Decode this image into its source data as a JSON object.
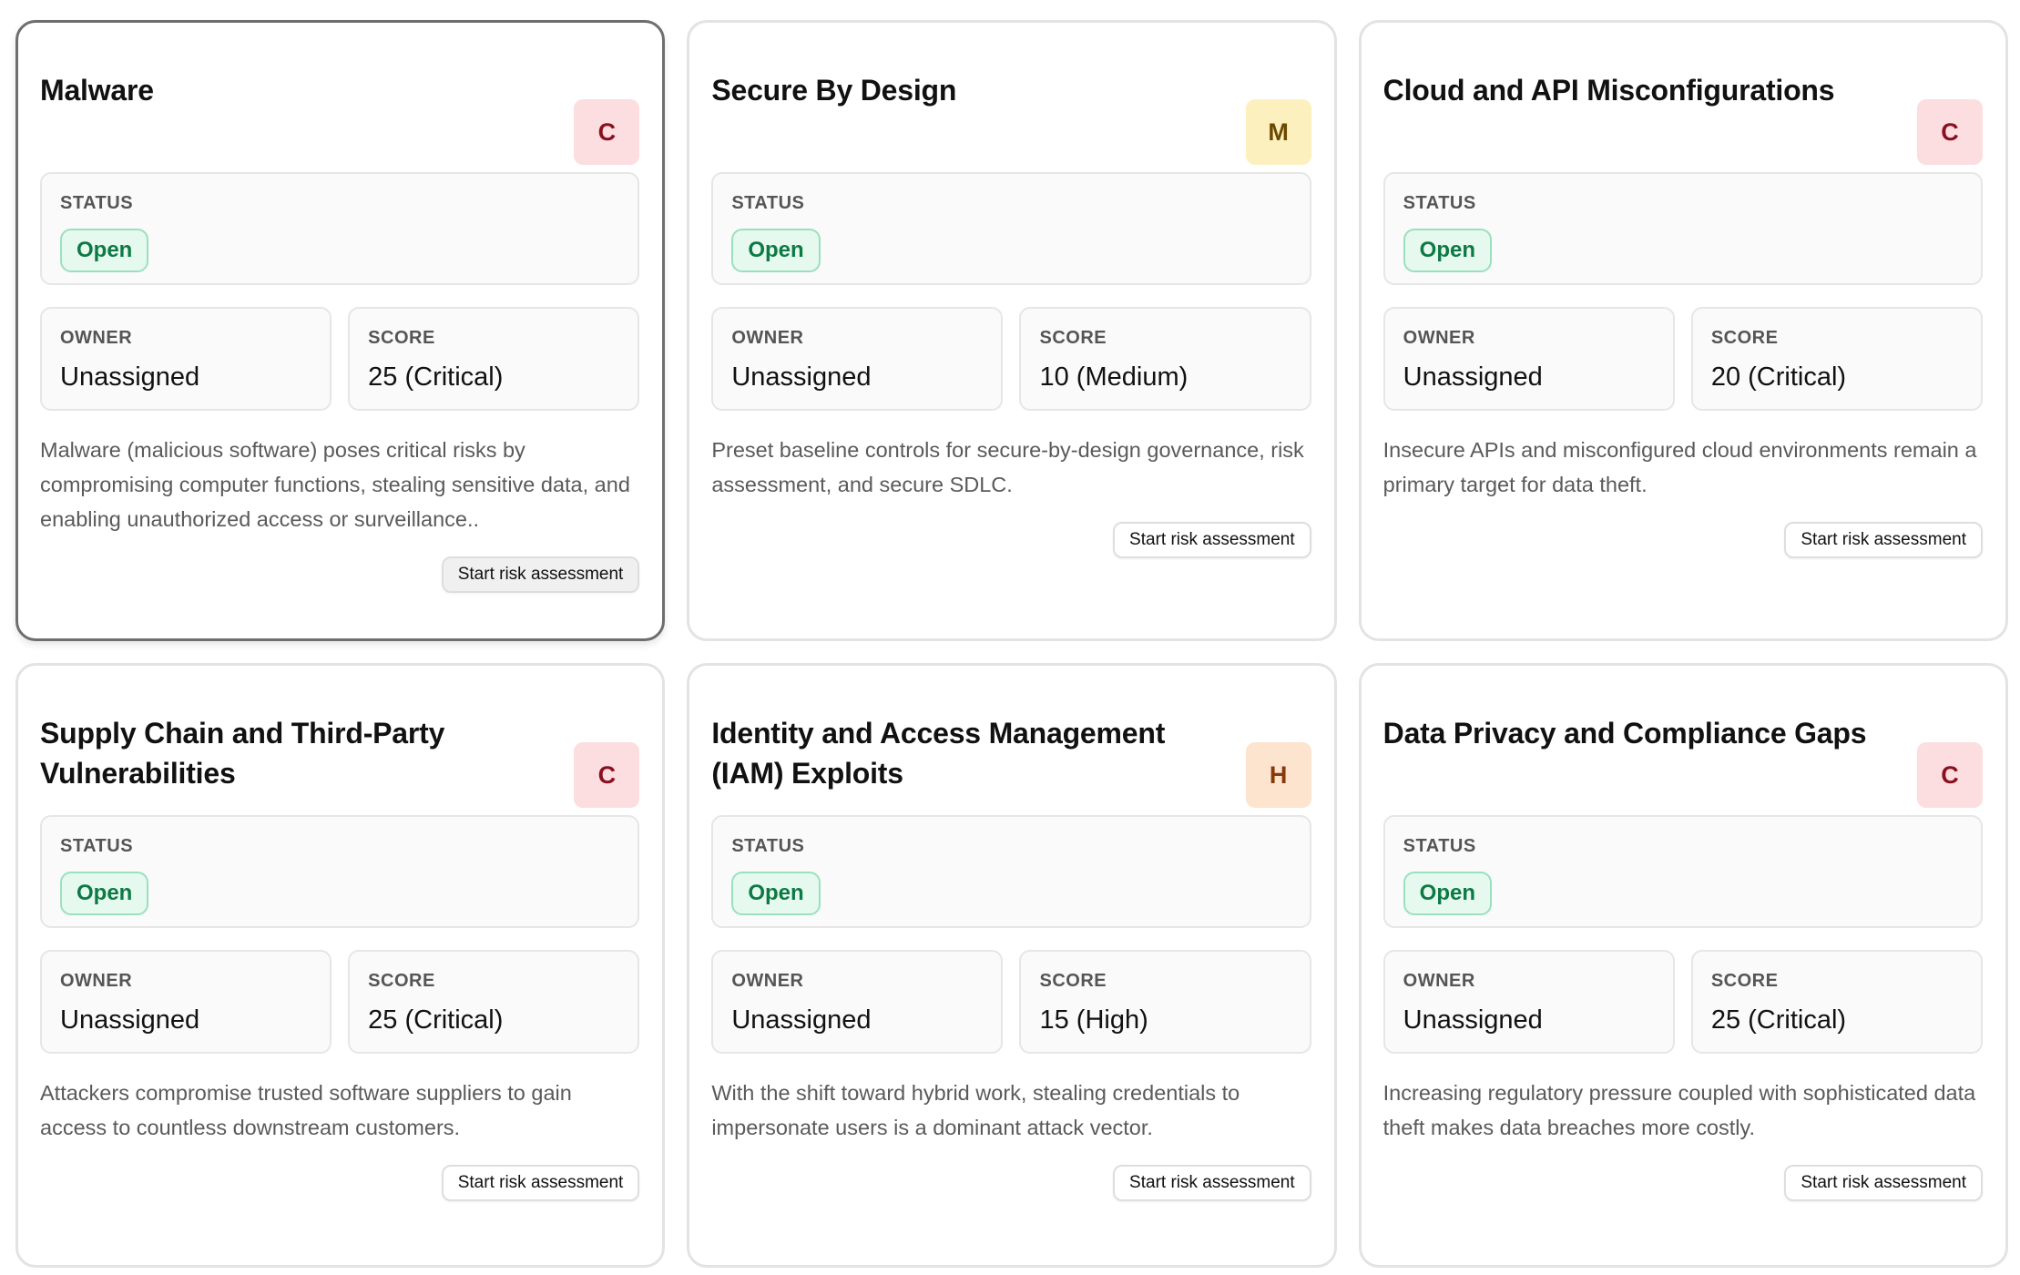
{
  "labels": {
    "status": "STATUS",
    "owner": "OWNER",
    "score": "SCORE",
    "action": "Start risk assessment"
  },
  "colors": {
    "critical_badge_bg": "#fcdde0",
    "medium_badge_bg": "#fdf0bf",
    "high_badge_bg": "#fde4cf",
    "open_pill_bg": "#e6f9ef",
    "open_pill_text": "#0d7a45"
  },
  "cards": [
    {
      "title": "Malware",
      "severity": "C",
      "status": "Open",
      "owner": "Unassigned",
      "score": "25 (Critical)",
      "description": "Malware (malicious software) poses critical risks by compromising computer functions, stealing sensitive data, and enabling unauthorized access or surveillance.."
    },
    {
      "title": "Secure By Design",
      "severity": "M",
      "status": "Open",
      "owner": "Unassigned",
      "score": "10 (Medium)",
      "description": "Preset baseline controls for secure-by-design governance, risk assessment, and secure SDLC."
    },
    {
      "title": "Cloud and API Misconfigurations",
      "severity": "C",
      "status": "Open",
      "owner": "Unassigned",
      "score": "20 (Critical)",
      "description": "Insecure APIs and misconfigured cloud environments remain a primary target for data theft."
    },
    {
      "title": "Supply Chain and Third-Party Vulnerabilities",
      "severity": "C",
      "status": "Open",
      "owner": "Unassigned",
      "score": "25 (Critical)",
      "description": "Attackers compromise trusted software suppliers to gain access to countless downstream customers."
    },
    {
      "title": "Identity and Access Management (IAM) Exploits",
      "severity": "H",
      "status": "Open",
      "owner": "Unassigned",
      "score": "15 (High)",
      "description": "With the shift toward hybrid work, stealing credentials to impersonate users is a dominant attack vector."
    },
    {
      "title": "Data Privacy and Compliance Gaps",
      "severity": "C",
      "status": "Open",
      "owner": "Unassigned",
      "score": "25 (Critical)",
      "description": "Increasing regulatory pressure coupled with sophisticated data theft makes data breaches more costly."
    }
  ]
}
